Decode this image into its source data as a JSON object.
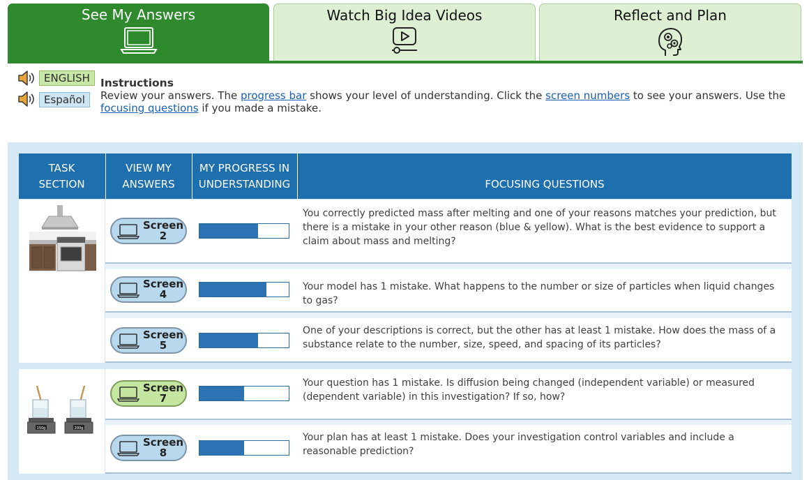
{
  "tabs": [
    {
      "label": "See My Answers",
      "icon": "laptop-icon",
      "active": true
    },
    {
      "label": "Watch Big Idea Videos",
      "icon": "video-play-icon",
      "active": false
    },
    {
      "label": "Reflect and Plan",
      "icon": "head-gears-icon",
      "active": false
    }
  ],
  "language": {
    "english": "ENGLISH",
    "spanish": "Español",
    "icon": "speaker-icon"
  },
  "instructions": {
    "title": "Instructions",
    "text_1": "Review your answers. The ",
    "link_progress": "progress bar",
    "text_2": " shows your level of understanding. Click the ",
    "link_screens": "screen numbers",
    "text_3": " to see your answers. Use the ",
    "link_focus": "focusing questions",
    "text_4": " if you made a mistake."
  },
  "table": {
    "headers": {
      "task_1": "TASK",
      "task_2": "SECTION",
      "view_1": "VIEW MY",
      "view_2": "ANSWERS",
      "prog_1": "MY PROGRESS IN",
      "prog_2": "UNDERSTANDING",
      "focus": "FOCUSING QUESTIONS"
    },
    "rows": [
      {
        "screen_word": "Screen",
        "screen_num": "2",
        "status": "pending",
        "progress": 0.66,
        "question": "You correctly predicted mass after melting and one of your reasons matches your prediction, but there is a mistake in your other reason (blue & yellow). What is the best evidence to support a claim about mass and melting?"
      },
      {
        "screen_word": "Screen",
        "screen_num": "4",
        "status": "pending",
        "progress": 0.75,
        "question": "Your model has 1 mistake. What happens to the number or size of particles when liquid changes to gas?"
      },
      {
        "screen_word": "Screen",
        "screen_num": "5",
        "status": "pending",
        "progress": 0.66,
        "question": "One of your descriptions is correct, but the other has at least 1 mistake. How does the mass of a substance relate to the number, size, speed, and spacing of its particles?"
      },
      {
        "screen_word": "Screen",
        "screen_num": "7",
        "status": "done",
        "progress": 0.5,
        "question": "Your question has 1 mistake. Is diffusion being changed (independent variable) or measured (dependent variable) in this investigation? If so, how?"
      },
      {
        "screen_word": "Screen",
        "screen_num": "8",
        "status": "pending",
        "progress": 0.5,
        "question": "Your plan has at least 1 mistake. Does your investigation control variables and include a reasonable prediction?"
      }
    ],
    "task_images": [
      {
        "icon": "kitchen-stove-icon"
      },
      {
        "icon": "beakers-on-scales-icon",
        "scale_labels": [
          "150g",
          "200g"
        ]
      }
    ]
  },
  "colors": {
    "tab_active": "#2f8a2e",
    "tab_inactive": "#def0d4",
    "header_blue": "#1d6fad",
    "progress_fill": "#2d72b3",
    "panel_bg": "#d4e8f5"
  }
}
